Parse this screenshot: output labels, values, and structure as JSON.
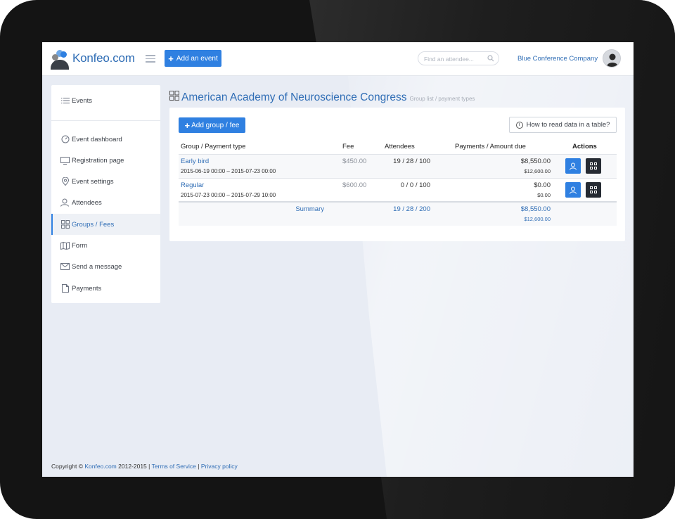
{
  "header": {
    "logo_text": "Konfeo.com",
    "add_event_label": "Add an event",
    "search_placeholder": "Find an attendee...",
    "company_name": "Blue Conference Company"
  },
  "sidebar": {
    "items": [
      {
        "label": "Events",
        "icon": "list-icon"
      },
      {
        "label": "Event dashboard",
        "icon": "gauge-icon"
      },
      {
        "label": "Registration page",
        "icon": "monitor-icon"
      },
      {
        "label": "Event settings",
        "icon": "location-pin-icon"
      },
      {
        "label": "Attendees",
        "icon": "users-icon"
      },
      {
        "label": "Groups / Fees",
        "icon": "grid-icon",
        "active": true
      },
      {
        "label": "Form",
        "icon": "map-icon"
      },
      {
        "label": "Send a message",
        "icon": "envelope-icon"
      },
      {
        "label": "Payments",
        "icon": "document-icon"
      }
    ]
  },
  "page": {
    "title": "American Academy of Neuroscience Congress",
    "subtitle": "Group list / payment types"
  },
  "toolbar": {
    "add_group_label": "Add group / fee",
    "help_label": "How to read data in a table?"
  },
  "table": {
    "headers": {
      "group": "Group / Payment type",
      "fee": "Fee",
      "attendees": "Attendees",
      "payments": "Payments / Amount due",
      "actions": "Actions"
    },
    "rows": [
      {
        "name": "Early bird",
        "dates": "2015-06-19 00:00 – 2015-07-23 00:00",
        "fee": "$450.00",
        "attendees": "19 / 28 / 100",
        "payments": "$8,550.00",
        "amount_due": "$12,600.00"
      },
      {
        "name": "Regular",
        "dates": "2015-07-23 00:00 – 2015-07-29 10:00",
        "fee": "$600.00",
        "attendees": "0 / 0 / 100",
        "payments": "$0.00",
        "amount_due": "$0.00"
      }
    ],
    "summary": {
      "label": "Summary",
      "attendees": "19 / 28 / 200",
      "payments": "$8,550.00",
      "amount_due": "$12,600.00"
    }
  },
  "footer": {
    "copyright_prefix": "Copyright ©",
    "brand_link": "Konfeo.com",
    "years": "2012-2015 |",
    "terms": "Terms of Service",
    "sep": "|",
    "privacy": "Privacy policy"
  },
  "colors": {
    "accent": "#2f80e1",
    "link": "#2f6db5",
    "dark_button": "#262b33",
    "background": "#e8ecf4"
  }
}
